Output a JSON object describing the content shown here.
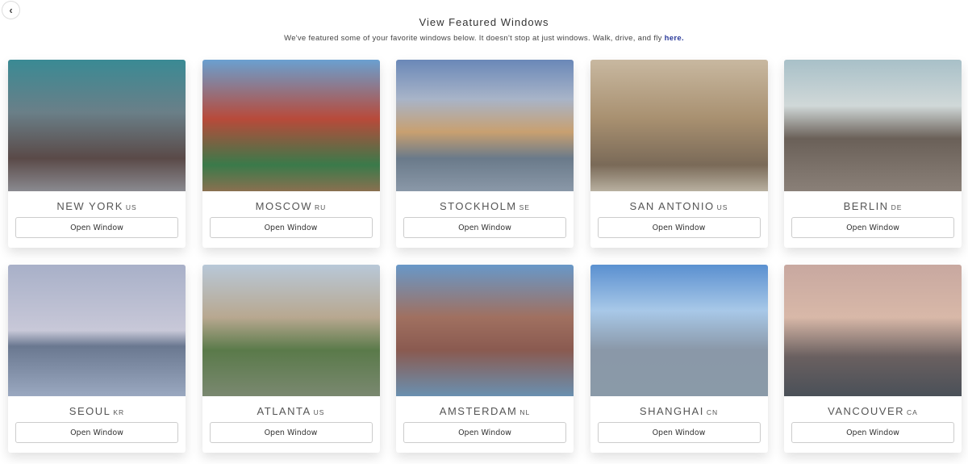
{
  "header": {
    "title": "View Featured Windows",
    "subtitle": "We've featured some of your favorite windows below. It doesn't stop at just windows. Walk, drive, and fly ",
    "link": "here."
  },
  "button_label": "Open Window",
  "cities": [
    {
      "name": "NEW YORK",
      "code": "US",
      "g": "linear-gradient(180deg,#3a8a94 0%,#6a7f88 40%,#5a4a48 75%,#8a8a90 100%)"
    },
    {
      "name": "MOSCOW",
      "code": "RU",
      "g": "linear-gradient(180deg,#6aa0d0 0%,#b84a3a 45%,#3a7a4a 80%,#8a7050 100%)"
    },
    {
      "name": "STOCKHOLM",
      "code": "SE",
      "g": "linear-gradient(180deg,#6a88b8 0%,#a8b4c8 30%,#c8a070 55%,#6a7a8a 75%,#8a98a8 100%)"
    },
    {
      "name": "SAN ANTONIO",
      "code": "US",
      "g": "linear-gradient(180deg,#c8b8a0 0%,#a89070 45%,#7a6a58 80%,#b8b0a0 100%)"
    },
    {
      "name": "BERLIN",
      "code": "DE",
      "g": "linear-gradient(180deg,#a8c0c8 0%,#d0d8d8 35%,#6a6058 60%,#8a8078 100%)"
    },
    {
      "name": "SEOUL",
      "code": "KR",
      "g": "linear-gradient(180deg,#a8b0c8 0%,#c8c8d8 50%,#6a7890 62%,#9aa8c0 100%)"
    },
    {
      "name": "ATLANTA",
      "code": "US",
      "g": "linear-gradient(180deg,#b8c8d8 0%,#b8a890 40%,#5a7a4a 65%,#7a8870 100%)"
    },
    {
      "name": "AMSTERDAM",
      "code": "NL",
      "g": "linear-gradient(180deg,#6898c8 0%,#a07060 40%,#8a5a50 65%,#6a90b0 100%)"
    },
    {
      "name": "SHANGHAI",
      "code": "CN",
      "g": "linear-gradient(180deg,#5a90d0 0%,#a8c8e8 35%,#8a98a8 65%,#8a9aa8 100%)"
    },
    {
      "name": "VANCOUVER",
      "code": "CA",
      "g": "linear-gradient(180deg,#c8a8a0 0%,#d8b8a8 40%,#6a6060 70%,#4a5058 100%)"
    }
  ]
}
